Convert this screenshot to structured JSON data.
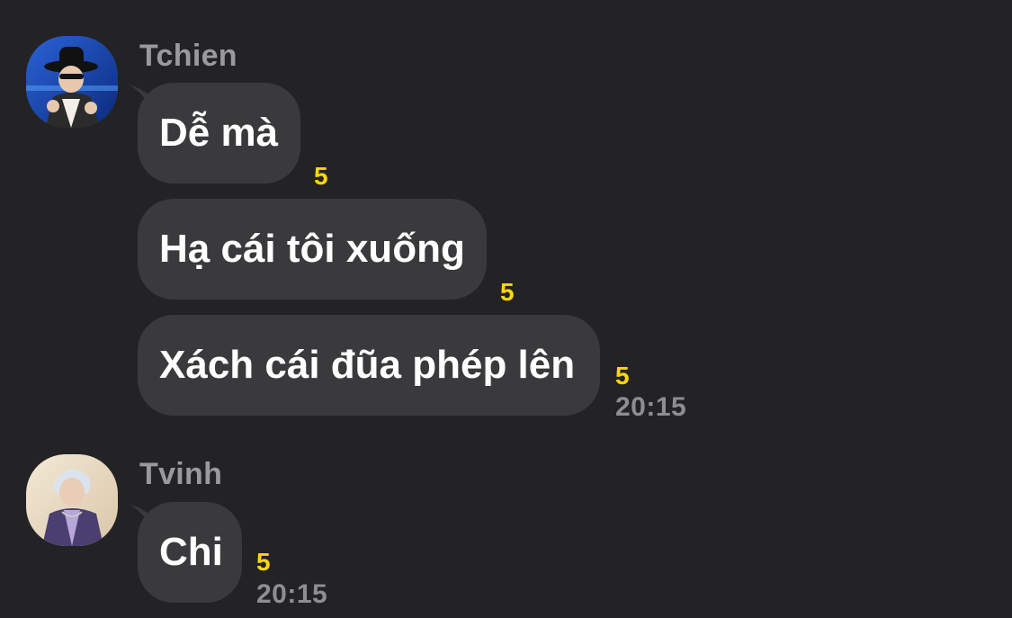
{
  "messages_group_1": {
    "sender": "Tchien",
    "avatar_desc": "person in black hat and sunglasses",
    "bubbles": [
      {
        "text": "Dễ mà",
        "reaction": "5"
      },
      {
        "text": "Hạ cái tôi xuống",
        "reaction": "5"
      },
      {
        "text": "Xách cái đũa phép lên",
        "reaction": "5",
        "time": "20:15"
      }
    ]
  },
  "messages_group_2": {
    "sender": "Tvinh",
    "avatar_desc": "person with light blond hair",
    "bubbles": [
      {
        "text": "Chi",
        "reaction": "5",
        "time": "20:15"
      }
    ]
  },
  "colors": {
    "background": "#232325",
    "bubble": "#3a3a3d",
    "reaction": "#ffd60a",
    "sender_name": "#9a9a9e",
    "timestamp": "#8e8e92"
  }
}
